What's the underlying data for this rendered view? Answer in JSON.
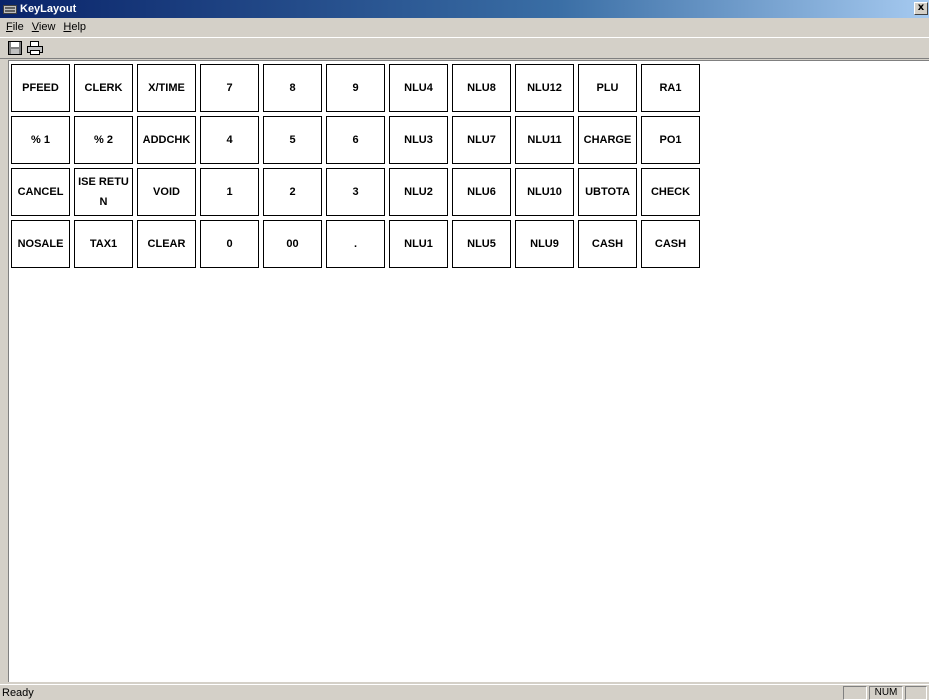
{
  "titlebar": {
    "title": "KeyLayout",
    "close_label": "x"
  },
  "menubar": {
    "items": [
      {
        "label": "File",
        "accel": "F",
        "rest": "ile"
      },
      {
        "label": "View",
        "accel": "V",
        "rest": "iew"
      },
      {
        "label": "Help",
        "accel": "H",
        "rest": "elp"
      }
    ]
  },
  "toolbar": {
    "buttons": [
      {
        "icon": "save-icon"
      },
      {
        "icon": "print-icon"
      }
    ]
  },
  "keyboard": {
    "rows": [
      [
        "PFEED",
        "CLERK",
        "X/TIME",
        "7",
        "8",
        "9",
        "NLU4",
        "NLU8",
        "NLU12",
        "PLU",
        "RA1"
      ],
      [
        "% 1",
        "% 2",
        "ADDCHK",
        "4",
        "5",
        "6",
        "NLU3",
        "NLU7",
        "NLU11",
        "CHARGE",
        "PO1"
      ],
      [
        "CANCEL",
        "ISE RETU N",
        "VOID",
        "1",
        "2",
        "3",
        "NLU2",
        "NLU6",
        "NLU10",
        "SUBTOTAL",
        "CHECK"
      ],
      [
        "NOSALE",
        "TAX1",
        "CLEAR",
        "0",
        "00",
        ".",
        "NLU1",
        "NLU5",
        "NLU9",
        "CASH",
        "CASH"
      ]
    ],
    "display": [
      [
        "PFEED",
        "CLERK",
        "X/TIME",
        "7",
        "8",
        "9",
        "NLU4",
        "NLU8",
        "NLU12",
        "PLU",
        "RA1"
      ],
      [
        "% 1",
        "% 2",
        "ADDCHK",
        "4",
        "5",
        "6",
        "NLU3",
        "NLU7",
        "NLU11",
        "CHARGE",
        "PO1"
      ],
      [
        "CANCEL",
        "ISE RETU",
        "VOID",
        "1",
        "2",
        "3",
        "NLU2",
        "NLU6",
        "NLU10",
        "UBTOTA",
        "CHECK"
      ],
      [
        "NOSALE",
        "TAX1",
        "CLEAR",
        "0",
        "00",
        ".",
        "NLU1",
        "NLU5",
        "NLU9",
        "CASH",
        "CASH"
      ]
    ]
  },
  "statusbar": {
    "text": "Ready",
    "num_indicator": "NUM"
  }
}
